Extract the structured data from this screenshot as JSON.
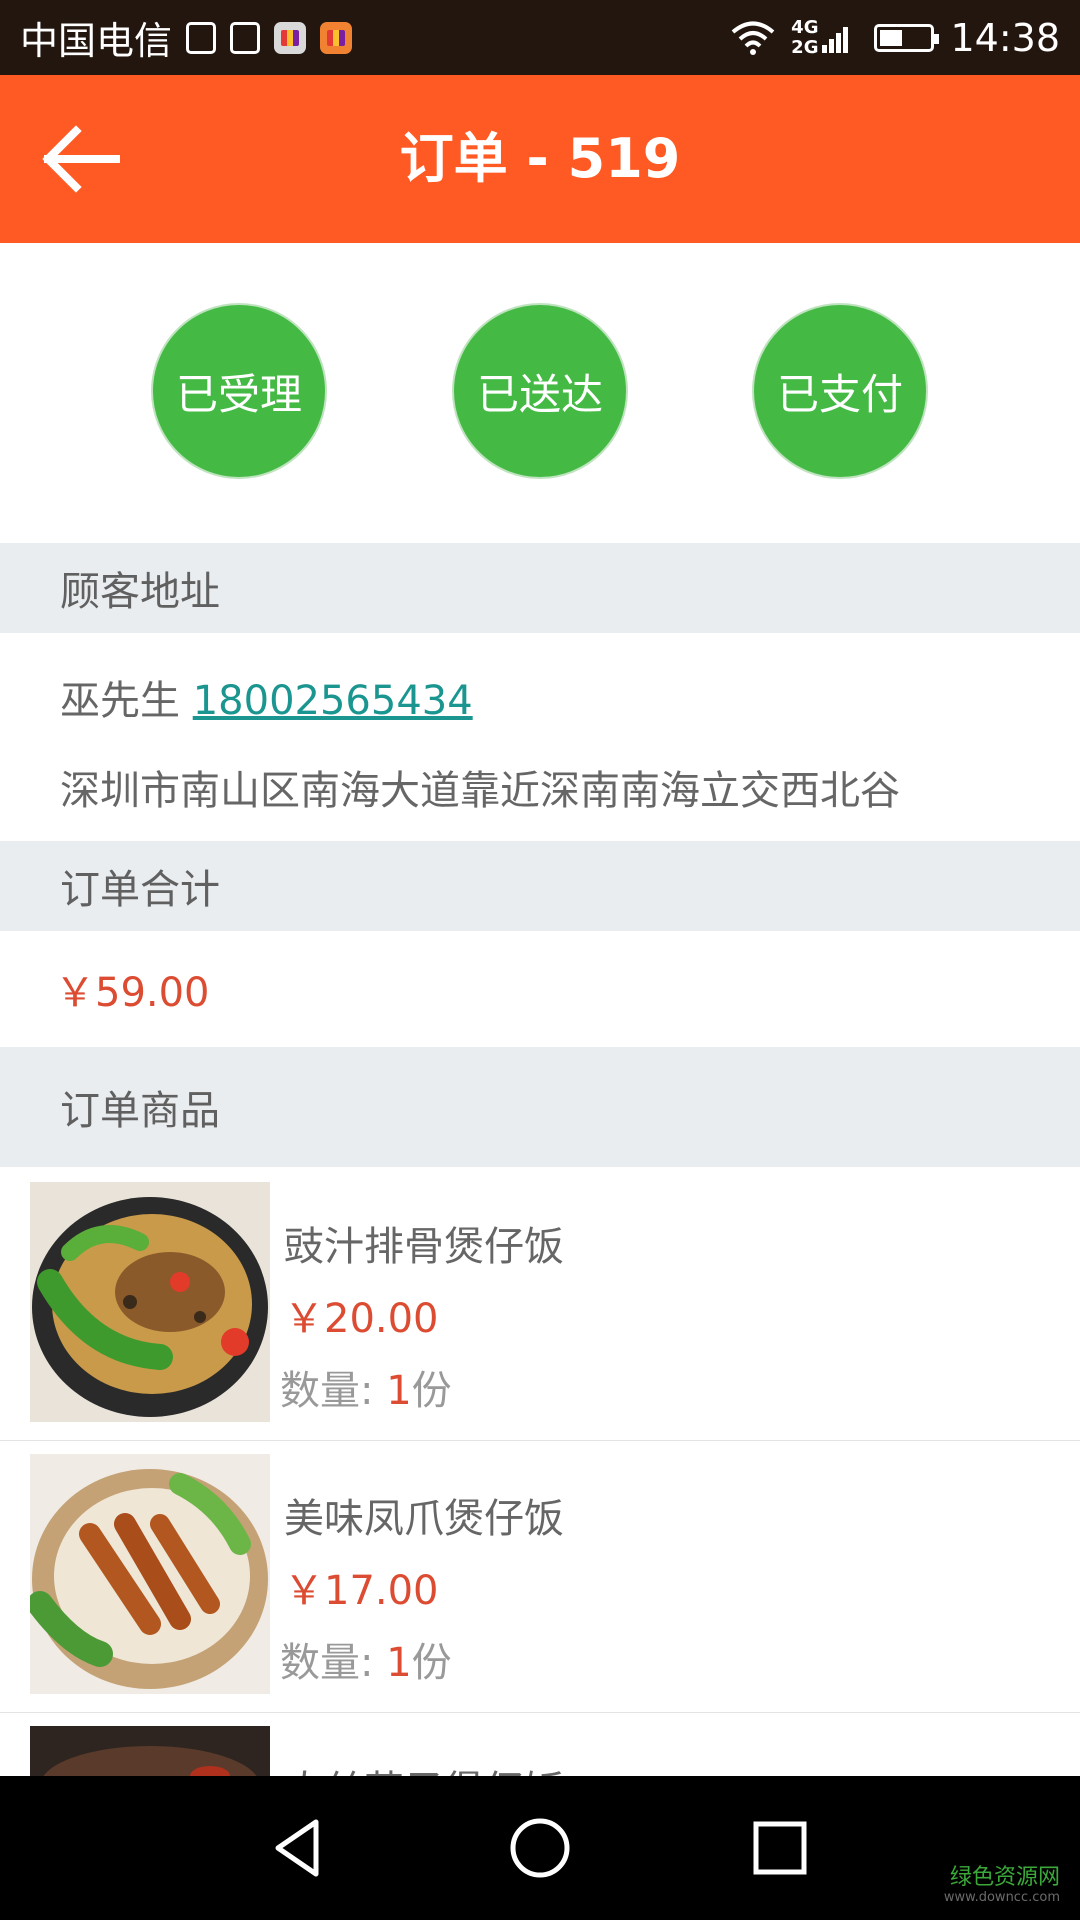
{
  "status_bar": {
    "carrier": "中国电信",
    "network_top": "4G",
    "network_bottom": "2G",
    "time": "14:38"
  },
  "app_bar": {
    "title": "订单 - 519"
  },
  "order_status": [
    "已受理",
    "已送达",
    "已支付"
  ],
  "sections": {
    "address_header": "顾客地址",
    "total_header": "订单合计",
    "items_header": "订单商品"
  },
  "customer": {
    "name": "巫先生",
    "phone": "18002565434",
    "address": "深圳市南山区南海大道靠近深南南海立交西北谷"
  },
  "total": "￥59.00",
  "products": [
    {
      "name": "豉汁排骨煲仔饭",
      "price": "￥20.00",
      "qty_label": "数量: ",
      "qty_value": "1",
      "qty_unit": "份"
    },
    {
      "name": "美味凤爪煲仔饭",
      "price": "￥17.00",
      "qty_label": "数量: ",
      "qty_value": "1",
      "qty_unit": "份"
    },
    {
      "name": "肉丝茄子煲仔饭"
    }
  ],
  "watermark": {
    "main": "绿色资源网",
    "sub": "www.downcc.com"
  },
  "colors": {
    "app_bar": "#ff5a24",
    "status_green": "#44ba45",
    "price_red": "#dc4c32",
    "link_teal": "#1a958f"
  }
}
